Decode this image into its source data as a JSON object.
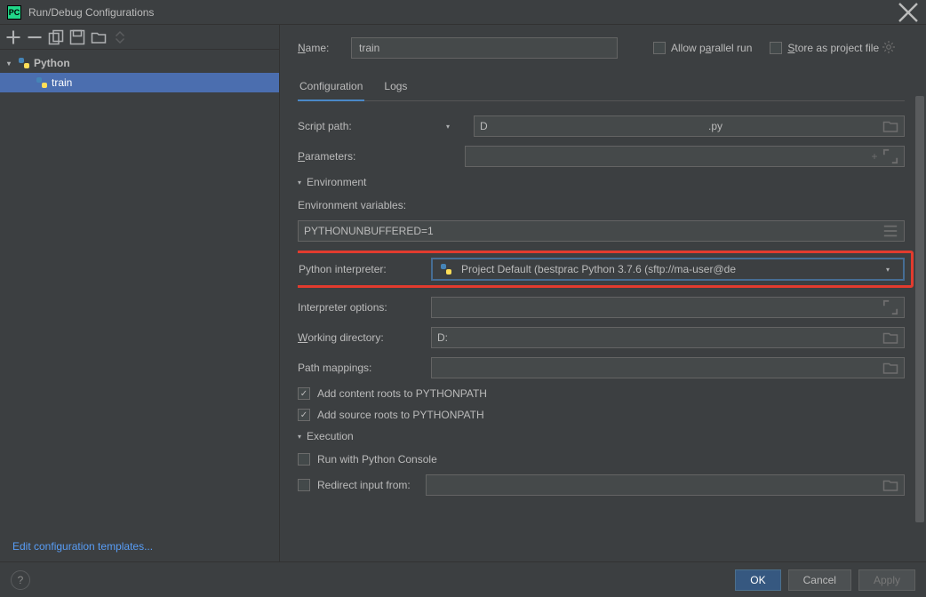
{
  "window": {
    "title": "Run/Debug Configurations"
  },
  "tree": {
    "root_label": "Python",
    "items": [
      {
        "label": "train"
      }
    ]
  },
  "edit_templates_link": "Edit configuration templates...",
  "form": {
    "name_label": "Name:",
    "name_value": "train",
    "allow_parallel_label": "Allow parallel run",
    "store_project_label": "Store as project file",
    "tabs": {
      "configuration": "Configuration",
      "logs": "Logs"
    },
    "script_path_label": "Script path:",
    "script_path_value_prefix": "D",
    "script_path_value_suffix": ".py",
    "parameters_label": "Parameters:",
    "env_section": "Environment",
    "env_vars_label": "Environment variables:",
    "env_vars_value": "PYTHONUNBUFFERED=1",
    "interpreter_label": "Python interpreter:",
    "interpreter_value": "Project Default (bestprac Python 3.7.6 (sftp://ma-user@de",
    "interpreter_options_label": "Interpreter options:",
    "working_dir_label": "Working directory:",
    "working_dir_value": "D:",
    "path_mappings_label": "Path mappings:",
    "add_content_roots": "Add content roots to PYTHONPATH",
    "add_source_roots": "Add source roots to PYTHONPATH",
    "execution_section": "Execution",
    "run_console": "Run with Python Console",
    "redirect_input": "Redirect input from:"
  },
  "buttons": {
    "ok": "OK",
    "cancel": "Cancel",
    "apply": "Apply"
  }
}
